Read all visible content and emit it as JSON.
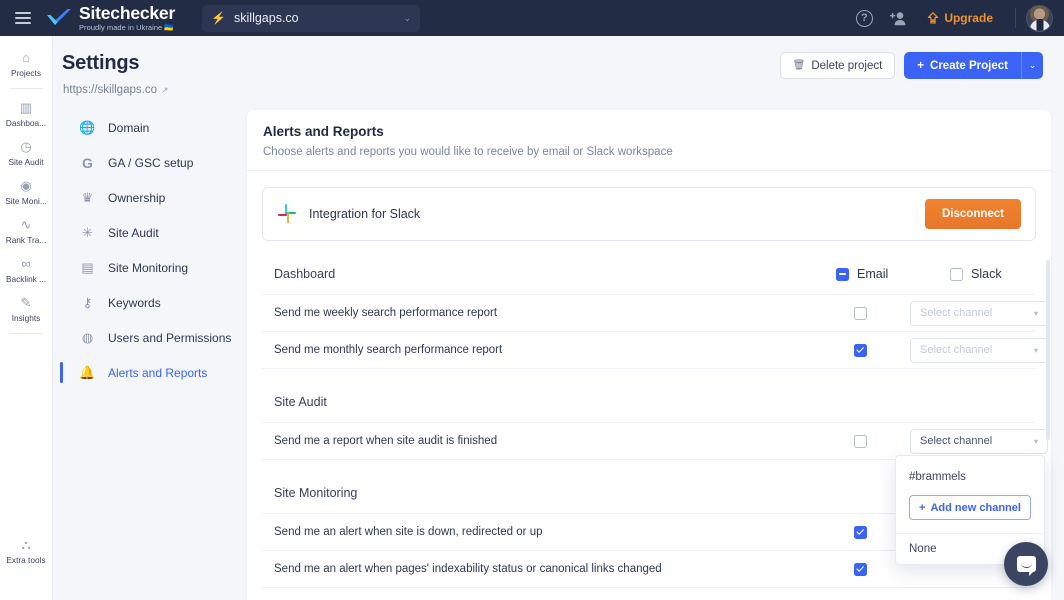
{
  "topbar": {
    "menu_icon": "hamburger-icon",
    "brand_name": "Sitechecker",
    "brand_tagline": "Proudly made in Ukraine 🇺🇦",
    "site_selector": {
      "icon": "lightning-icon",
      "value": "skillgaps.co",
      "caret": "⌄"
    },
    "help_icon": "question-mark-icon",
    "invite_icon": "add-user-icon",
    "upgrade_label": "Upgrade",
    "upgrade_icon": "upgrade-arrow-icon",
    "avatar": "user-avatar"
  },
  "rail": {
    "items": [
      {
        "icon": "home-icon",
        "label": "Projects"
      },
      {
        "icon": "dashboard-icon",
        "label": "Dashboa..."
      },
      {
        "icon": "gauge-icon",
        "label": "Site Audit"
      },
      {
        "icon": "pulse-icon",
        "label": "Site Moni..."
      },
      {
        "icon": "trend-icon",
        "label": "Rank Tra..."
      },
      {
        "icon": "link-icon",
        "label": "Backlink ..."
      },
      {
        "icon": "magic-wand-icon",
        "label": "Insights"
      }
    ],
    "bottom": {
      "icon": "grid-plus-icon",
      "label": "Extra tools"
    }
  },
  "page": {
    "title": "Settings",
    "url": "https://skillgaps.co",
    "url_icon": "external-link-icon",
    "delete_button": "Delete project",
    "delete_icon": "trash-icon",
    "create_button": "Create Project",
    "create_icon": "plus-icon",
    "create_caret": "⌄"
  },
  "settings_nav": {
    "items": [
      {
        "icon": "globe-icon",
        "label": "Domain",
        "active": false
      },
      {
        "icon": "google-g-icon",
        "label": "GA / GSC setup",
        "active": false
      },
      {
        "icon": "crown-icon",
        "label": "Ownership",
        "active": false
      },
      {
        "icon": "bug-icon",
        "label": "Site Audit",
        "active": false
      },
      {
        "icon": "monitor-search-icon",
        "label": "Site Monitoring",
        "active": false
      },
      {
        "icon": "key-icon",
        "label": "Keywords",
        "active": false
      },
      {
        "icon": "user-circle-icon",
        "label": "Users and Permissions",
        "active": false
      },
      {
        "icon": "bell-icon",
        "label": "Alerts and Reports",
        "active": true
      }
    ]
  },
  "card": {
    "title": "Alerts and Reports",
    "subtitle": "Choose alerts and reports you would like to receive by email or Slack workspace",
    "integration": {
      "icon": "slack-logo-icon",
      "title": "Integration for Slack",
      "button": "Disconnect"
    },
    "columns": {
      "email": "Email",
      "slack": "Slack"
    },
    "email_header_state": "indeterminate",
    "slack_header_state": "unchecked",
    "select_placeholder": "Select channel",
    "sections": [
      {
        "name": "Dashboard",
        "has_columns": true,
        "rows": [
          {
            "label": "Send me weekly search performance report",
            "email_checked": false,
            "channel": "Select channel",
            "channel_selected": false
          },
          {
            "label": "Send me monthly search performance report",
            "email_checked": true,
            "channel": "Select channel",
            "channel_selected": false
          }
        ]
      },
      {
        "name": "Site Audit",
        "has_columns": false,
        "rows": [
          {
            "label": "Send me a report when site audit is finished",
            "email_checked": false,
            "channel": "Select channel",
            "channel_selected": true
          }
        ]
      },
      {
        "name": "Site Monitoring",
        "has_columns": false,
        "rows": [
          {
            "label": "Send me an alert when site is down, redirected or up",
            "email_checked": true,
            "channel": "",
            "channel_selected": false
          },
          {
            "label": "Send me an alert when pages' indexability status or canonical links changed",
            "email_checked": true,
            "channel": "",
            "channel_selected": false
          }
        ]
      }
    ]
  },
  "dropdown": {
    "option": "#brammels",
    "add_button": "Add new channel",
    "add_icon": "plus-icon",
    "none_option": "None"
  },
  "intercom": {
    "icon": "chat-bubble-icon"
  },
  "colors": {
    "accent_blue": "#3b63f6",
    "topbar_bg": "#232c45",
    "orange": "#ef7f2d",
    "page_bg": "#f4f6fa"
  }
}
